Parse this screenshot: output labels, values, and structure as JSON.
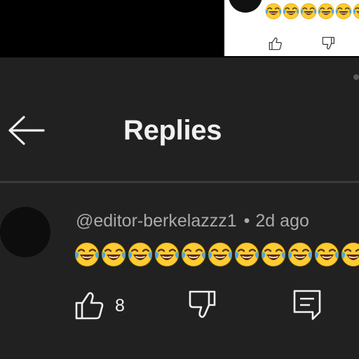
{
  "colors": {
    "panel_bg": "#212121",
    "top_bg": "#000000",
    "preview_bg": "#ffffff",
    "text_primary": "#f1f1f1",
    "text_secondary": "#aaaaaa",
    "divider": "#3a3a3a"
  },
  "preview": {
    "emoji_icon": "face-with-tears-of-joy-icon",
    "like_icon": "thumbs-up-icon",
    "dislike_icon": "thumbs-down-icon"
  },
  "header": {
    "back_icon": "arrow-left-icon",
    "title": "Replies"
  },
  "comment": {
    "author": "@editor-berkelazzz1",
    "separator": "•",
    "timestamp": "2d ago",
    "emoji_icon": "face-with-tears-of-joy-icon",
    "actions": {
      "like_count": "8",
      "like_icon": "thumbs-up-icon",
      "dislike_icon": "thumbs-down-icon",
      "reply_icon": "comment-reply-icon"
    }
  }
}
